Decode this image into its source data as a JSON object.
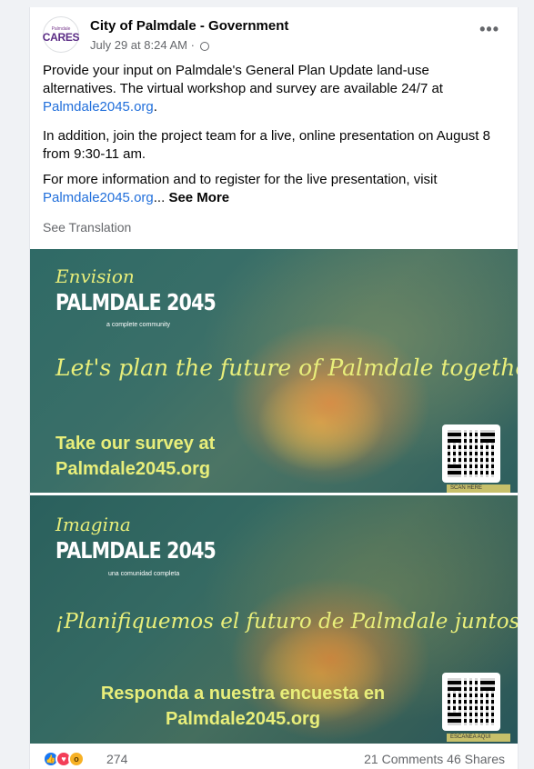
{
  "post": {
    "avatar_small": "Palmdale",
    "avatar_big": "CARES",
    "page_name": "City of Palmdale - Government",
    "timestamp": "July 29 at 8:24 AM",
    "separator": "·",
    "paragraph1_text": "Provide your input on Palmdale's General Plan Update land-use alternatives.  The virtual workshop and survey are available 24/7 at",
    "paragraph1_link": "Palmdale2045.org",
    "paragraph1_end": ".",
    "paragraph2_text": "In addition, join the project team for a live, online presentation on August 8 from 9:30-11 am.",
    "paragraph3_text": "For more information and to register for the live presentation, visit",
    "paragraph3_link": "Palmdale2045.org",
    "paragraph3_ellipsis": "... ",
    "see_more": "See More",
    "see_translation": "See Translation"
  },
  "banner_en": {
    "script_word": "Envision",
    "title": "PALMDALE 2045",
    "tagline": "a complete community",
    "slogan": "Let's plan the future of Palmdale together!",
    "cta_line1": "Take our survey at",
    "cta_line2": "Palmdale2045.org",
    "scan_label": "SCAN HERE"
  },
  "banner_es": {
    "script_word": "Imagina",
    "title": "PALMDALE 2045",
    "tagline": "una comunidad completa",
    "slogan": "¡Planifiquemos el futuro de Palmdale juntos!",
    "cta_line1": "Responda a nuestra encuesta en",
    "cta_line2": "Palmdale2045.org",
    "scan_label": "ESCANEA AQUI"
  },
  "footer": {
    "reaction_count": "274",
    "comments": "21 Comments",
    "shares": "46 Shares"
  },
  "icons": [
    "globe-icon",
    "more-options-icon",
    "like-reaction-icon",
    "love-reaction-icon",
    "wow-reaction-icon",
    "qr-code-icon"
  ],
  "colors": {
    "link": "#216fdb",
    "banner_text": "#e8ee7a",
    "like": "#1877f2",
    "love": "#f33e58",
    "wow": "#f7b125"
  }
}
